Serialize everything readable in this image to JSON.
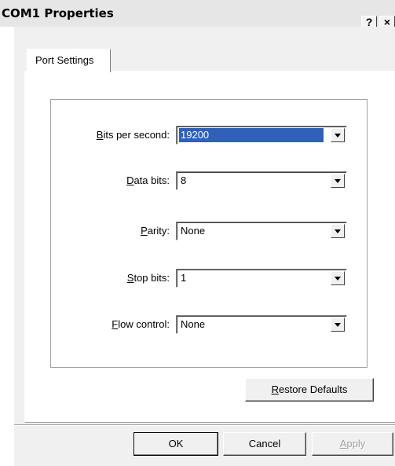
{
  "window": {
    "title": "COM1 Properties",
    "help_glyph": "?",
    "close_glyph": "×"
  },
  "tabs": [
    {
      "label": "Port Settings",
      "selected": true
    }
  ],
  "fields": [
    {
      "accel": "B",
      "rest": "its per second:",
      "value": "19200",
      "focused": true
    },
    {
      "accel": "D",
      "rest": "ata bits:",
      "value": "8",
      "focused": false
    },
    {
      "accel": "P",
      "rest": "arity:",
      "value": "None",
      "focused": false
    },
    {
      "accel": "S",
      "rest": "top bits:",
      "value": "1",
      "focused": false
    },
    {
      "accel": "F",
      "rest": "low control:",
      "value": "None",
      "focused": false
    }
  ],
  "restore_button": {
    "accel": "R",
    "rest": "estore Defaults"
  },
  "footer": {
    "ok": "OK",
    "cancel": "Cancel",
    "apply_accel": "A",
    "apply_rest": "pply"
  },
  "colors": {
    "dialog_bg": "#f0f0f0",
    "selection": "#3060b8"
  }
}
